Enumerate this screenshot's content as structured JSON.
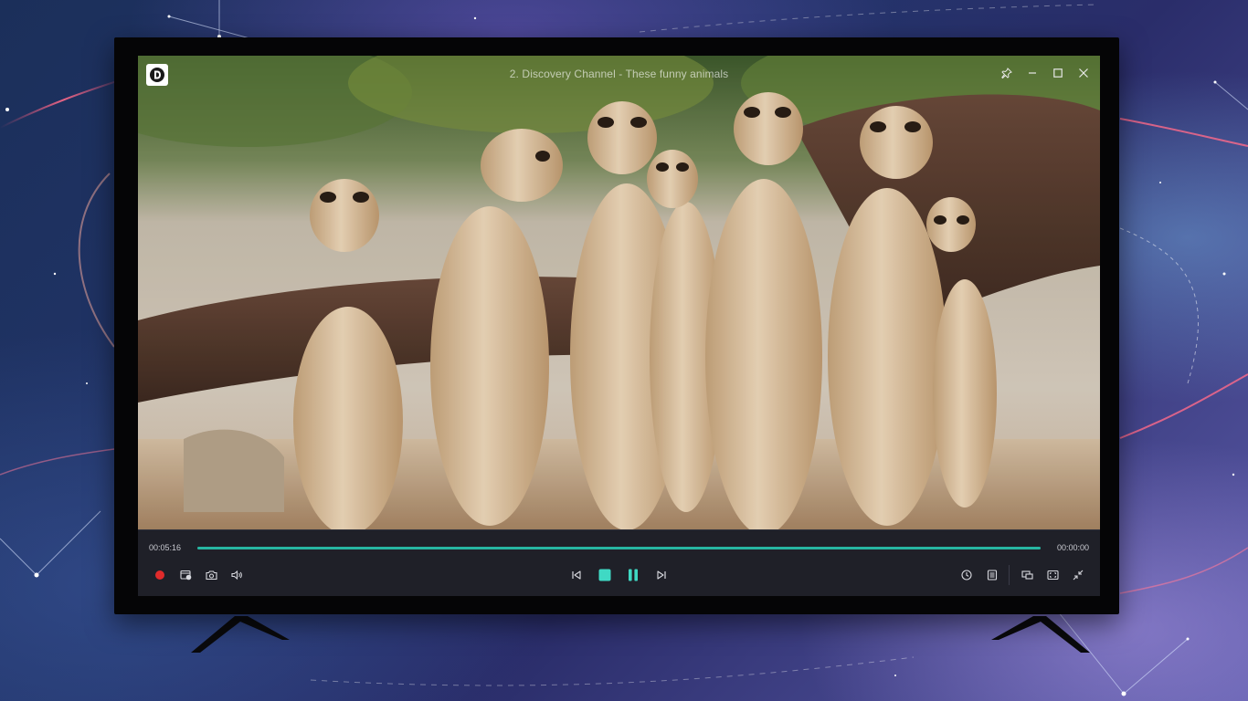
{
  "window": {
    "title": "2. Discovery Channel - These funny animals"
  },
  "player": {
    "elapsed": "00:05:16",
    "remaining": "00:00:00",
    "progress_fraction": 1.0
  },
  "colors": {
    "accent": "#27b6a2",
    "record": "#e02b2b",
    "control_bar": "#1f2028"
  },
  "icons": {
    "logo": "discovery-logo-icon",
    "pin": "pin-icon",
    "minimize": "minimize-icon",
    "maximize": "maximize-icon",
    "close": "close-icon",
    "record": "record-icon",
    "record_screen": "record-screen-icon",
    "snapshot": "camera-icon",
    "volume": "volume-icon",
    "previous": "skip-previous-icon",
    "stop": "stop-icon",
    "pause": "pause-icon",
    "next": "skip-next-icon",
    "history": "clock-icon",
    "playlist": "playlist-icon",
    "mini_player": "picture-in-picture-icon",
    "fullscreen": "fullscreen-icon",
    "collapse": "collapse-icon"
  }
}
